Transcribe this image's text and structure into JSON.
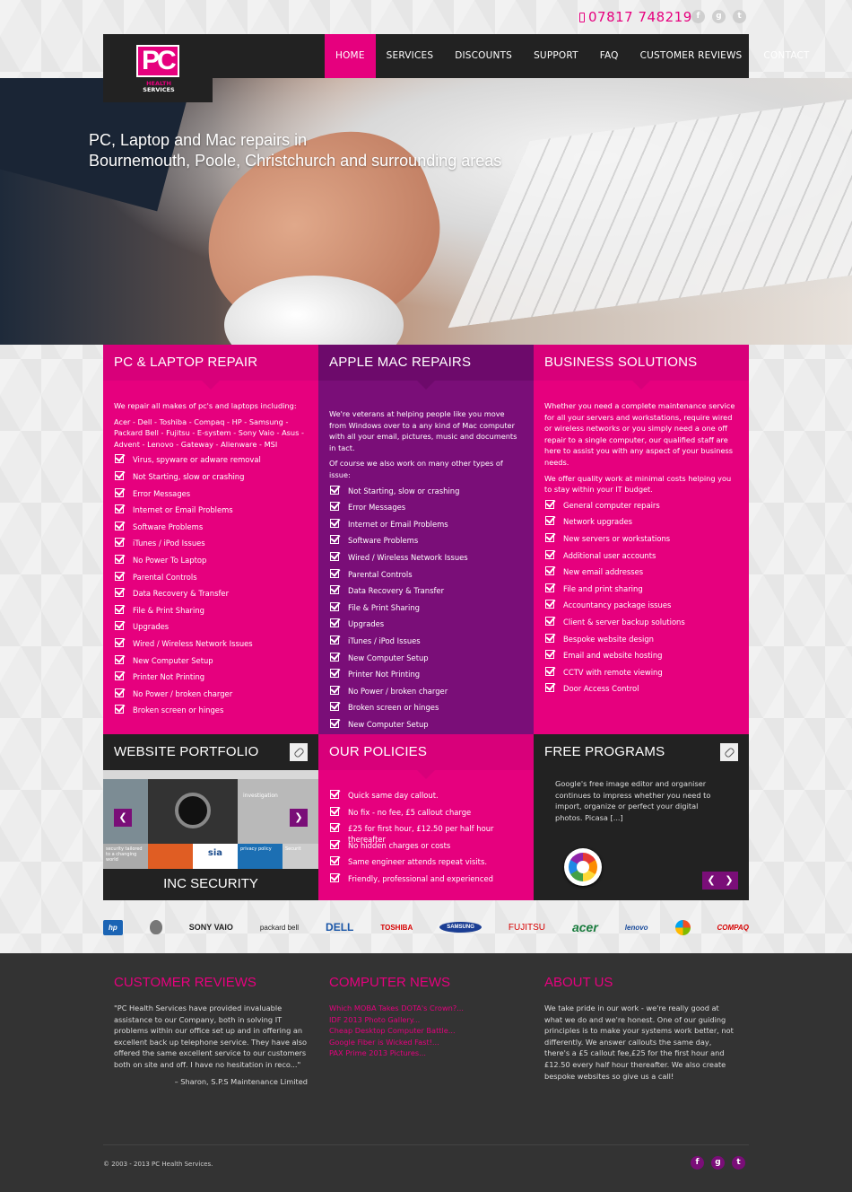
{
  "header": {
    "phone": "07817 748219",
    "social": [
      "f",
      "g",
      "t"
    ],
    "logo": {
      "mark": "PC",
      "line1": "HEALTH",
      "line2": "SERVICES"
    },
    "nav": [
      "HOME",
      "SERVICES",
      "DISCOUNTS",
      "SUPPORT",
      "FAQ",
      "CUSTOMER REVIEWS",
      "CONTACT"
    ]
  },
  "hero": {
    "line1": "PC, Laptop and Mac repairs in",
    "line2": "Bournemouth, Poole, Christchurch and surrounding areas"
  },
  "pc": {
    "title": "PC & LAPTOP REPAIR",
    "intro": "We repair all makes of pc's and laptops including:",
    "brands": "Acer - Dell - Toshiba - Compaq - HP - Samsung - Packard Bell - Fujitsu - E-system - Sony Vaio - Asus - Advent - Lenovo - Gateway - Alienware - MSI",
    "items": [
      "Virus, spyware or adware removal",
      "Not Starting, slow or crashing",
      "Error Messages",
      "Internet or Email Problems",
      "Software Problems",
      "iTunes / iPod Issues",
      "No Power To Laptop",
      "Parental Controls",
      "Data Recovery & Transfer",
      "File & Print Sharing",
      "Upgrades",
      "Wired / Wireless Network Issues",
      "New Computer Setup",
      "Printer Not Printing",
      "No Power / broken charger",
      "Broken screen or hinges"
    ]
  },
  "mac": {
    "title": "APPLE MAC REPAIRS",
    "intro": "We're veterans at helping people like you move from Windows over to a any kind of Mac computer with all your email, pictures, music and documents in tact.",
    "intro2": "Of course we also work on many other types of issue:",
    "items": [
      "Not Starting, slow or crashing",
      "Error Messages",
      "Internet or Email Problems",
      "Software Problems",
      "Wired / Wireless Network Issues",
      "Parental Controls",
      "Data Recovery & Transfer",
      "File & Print Sharing",
      "Upgrades",
      "iTunes / iPod Issues",
      "New Computer Setup",
      "Printer Not Printing",
      "No Power / broken charger",
      "Broken screen or hinges",
      "New Computer Setup"
    ]
  },
  "biz": {
    "title": "BUSINESS SOLUTIONS",
    "intro": "Whether you need a complete maintenance service for all your servers and workstations, require wired or wireless networks or you simply need a one off repair to a single computer, our qualified staff are here to assist you with any aspect of your business needs.",
    "intro2": "We offer quality work at minimal costs helping you to stay within your IT budget.",
    "items": [
      "General computer repairs",
      "Network upgrades",
      "New servers or workstations",
      "Additional user accounts",
      "New email addresses",
      "File and print sharing",
      "Accountancy package issues",
      "Client & server backup solutions",
      "Bespoke website design",
      "Email and website hosting",
      "CCTV with remote viewing",
      "Door Access Control"
    ]
  },
  "portfolio": {
    "title": "WEBSITE PORTFOLIO",
    "caption": "INC SECURITY",
    "img_text": [
      "investigation",
      "security tailored to a changing world",
      "sia",
      "privacy policy",
      "Securit",
      "Test"
    ]
  },
  "policies": {
    "title": "OUR POLICIES",
    "items": [
      "Quick same day callout.",
      "No fix - no fee, £5 callout charge",
      "£25 for first hour, £12.50 per half hour thereafter",
      "No hidden charges or costs",
      "Same engineer attends repeat visits.",
      "Friendly, professional and experienced"
    ]
  },
  "programs": {
    "title": "FREE PROGRAMS",
    "text": "Google's free image editor and organiser continues to impress whether you need to import, organize or perfect your digital photos. Picasa [...]"
  },
  "brands": [
    "hp",
    "",
    "SONY VAIO",
    "packard bell",
    "DELL",
    "TOSHIBA",
    "SAMSUNG",
    "FUJITSU",
    "acer",
    "lenovo",
    "",
    "COMPAQ"
  ],
  "footer": {
    "reviews": {
      "title": "CUSTOMER REVIEWS",
      "text": "\"PC Health Services have provided invaluable assistance to our Company, both in solving IT problems within our office set up and in offering an excellent back up telephone service. They have also offered the same excellent service to our customers both on site and off. I have no hesitation in reco...\"",
      "author": "– Sharon, S.P.S Maintenance Limited"
    },
    "news": {
      "title": "COMPUTER NEWS",
      "links": [
        "Which MOBA Takes DOTA's Crown?...",
        "IDF 2013 Photo Gallery...",
        "Cheap Desktop Computer Battle...",
        "Google Fiber is Wicked Fast!...",
        "PAX Prime 2013 Pictures..."
      ]
    },
    "about": {
      "title": "ABOUT US",
      "text": "We take pride in our work - we're really good at what we do and we're honest. One of our guiding principles is to make your systems work better, not differently. We answer callouts the same day, there's a £5 callout fee,£25 for the first hour and £12.50 every half hour thereafter. We also create bespoke websites so give us a call!"
    },
    "copyright": "© 2003 - 2013 PC Health Services.",
    "social": [
      "f",
      "g",
      "t"
    ]
  }
}
